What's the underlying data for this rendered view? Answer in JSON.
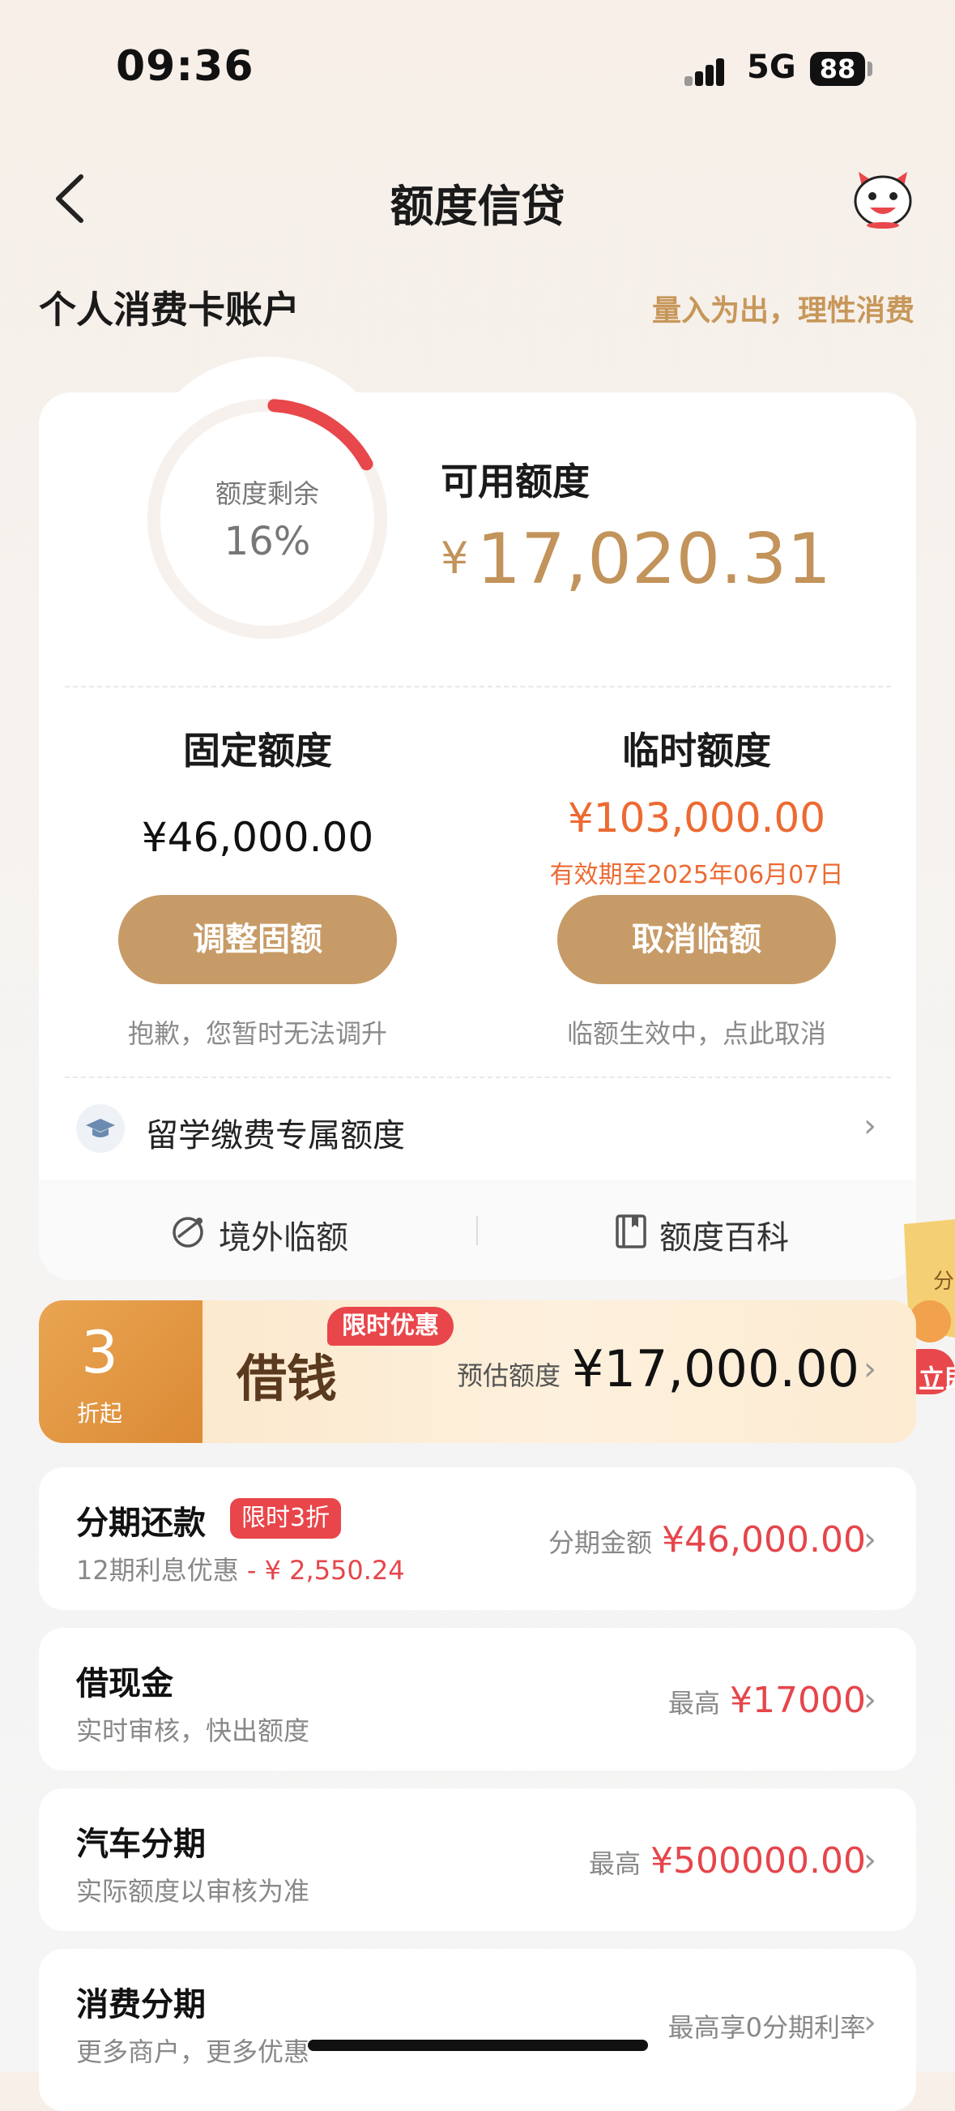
{
  "status": {
    "time": "09:36",
    "network": "5G",
    "battery": "88"
  },
  "nav": {
    "title": "额度信贷"
  },
  "account": {
    "name": "个人消费卡账户",
    "slogan": "量入为出，理性消费"
  },
  "ring": {
    "label": "额度剩余",
    "percent_text": "16%",
    "remaining_fraction": 0.16,
    "arc_color": "#e8474b"
  },
  "available": {
    "label": "可用额度",
    "currency": "¥",
    "amount": "17,020.31"
  },
  "fixed": {
    "title": "固定额度",
    "amount": "¥46,000.00",
    "button": "调整固额",
    "hint": "抱歉，您暂时无法调升"
  },
  "temporary": {
    "title": "临时额度",
    "amount": "¥103,000.00",
    "expiry": "有效期至2025年06月07日",
    "button": "取消临额",
    "hint": "临额生效中，点此取消"
  },
  "study": {
    "label": "留学缴费专属额度"
  },
  "footer_links": [
    {
      "label": "境外临额"
    },
    {
      "label": "额度百科"
    }
  ],
  "banner": {
    "discount_num": "3",
    "discount_txt": "折起",
    "title": "借钱",
    "tag": "限时优惠",
    "est_label": "预估额度",
    "est_amount": "¥17,000.00"
  },
  "rows": [
    {
      "title": "分期还款",
      "tag": "限时3折",
      "sub": "12期利息优惠",
      "sub_red": " - ¥ 2,550.24",
      "right_label": "分期金额",
      "right_value": "¥46,000.00"
    },
    {
      "title": "借现金",
      "sub": "实时审核，快出额度",
      "right_label": "最高",
      "right_value": "¥17000"
    },
    {
      "title": "汽车分期",
      "sub": "实际额度以审核为准",
      "right_label": "最高",
      "right_value": "¥500000.00"
    },
    {
      "title": "消费分期",
      "sub": "更多商户，更多优惠",
      "right_label": "最高享0分期利率",
      "right_value": ""
    }
  ],
  "side_float": {
    "top_text": "分",
    "bottom_text": "立即"
  },
  "colors": {
    "accent_gold": "#c79b67",
    "accent_red": "#e5464b",
    "accent_orange": "#ec6a32"
  }
}
